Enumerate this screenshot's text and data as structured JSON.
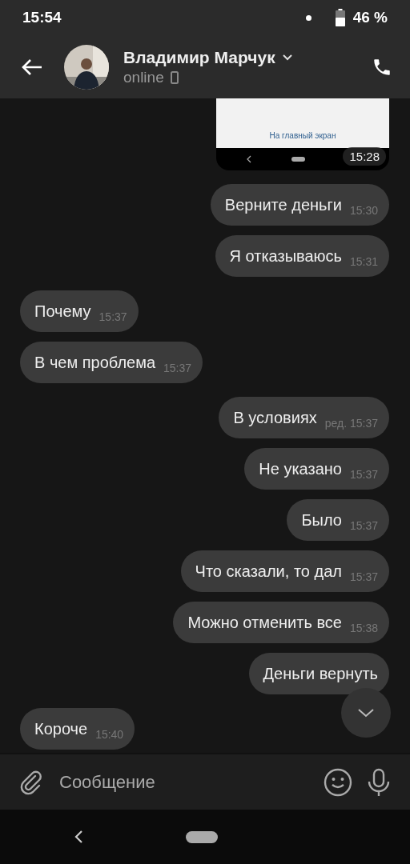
{
  "status_bar": {
    "time": "15:54",
    "battery": "46 %"
  },
  "header": {
    "name": "Владимир Марчук",
    "presence": "online"
  },
  "messages": [
    {
      "kind": "screenshot",
      "caption": "На главный экран",
      "time": "15:28"
    },
    {
      "kind": "outgoing",
      "text": "Верните деньги",
      "time": "15:30"
    },
    {
      "kind": "outgoing",
      "text": "Я отказываюсь",
      "time": "15:31"
    },
    {
      "kind": "incoming",
      "text": "Почему",
      "time": "15:37"
    },
    {
      "kind": "incoming",
      "text": "В чем проблема",
      "time": "15:37"
    },
    {
      "kind": "outgoing",
      "text": "В условиях",
      "time": "ред. 15:37"
    },
    {
      "kind": "outgoing",
      "text": "Не указано",
      "time": "15:37"
    },
    {
      "kind": "outgoing",
      "text": "Было",
      "time": "15:37"
    },
    {
      "kind": "outgoing",
      "text": "Что сказали, то дал",
      "time": "15:37"
    },
    {
      "kind": "outgoing",
      "text": "Можно отменить все",
      "time": "15:38"
    },
    {
      "kind": "outgoing",
      "text": "Деньги вернуть"
    },
    {
      "kind": "incoming",
      "text": "Короче",
      "time": "15:40"
    }
  ],
  "composer": {
    "placeholder": "Сообщение"
  }
}
